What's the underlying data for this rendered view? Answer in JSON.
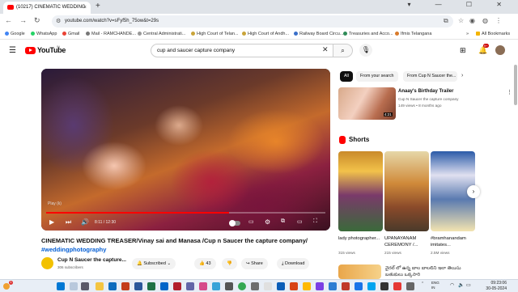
{
  "browser": {
    "tab_title": "(10217) CINEMATIC WEDDING",
    "tab_close": "×",
    "new_tab": "+",
    "window_controls": "▾ — ☐ ✕",
    "url": "youtube.com/watch?v=sFyf5h_75ow&t=29s",
    "bookmarks": [
      "Google",
      "WhatsApp",
      "Gmail",
      "Mail - RAMCHANDE...",
      "Central Administrati...",
      "High Court of Telan...",
      "High Court of Andh...",
      "Railway Board Circu...",
      "Treasuries and Acco...",
      "Ifmis Telangana"
    ],
    "all_bookmarks": "All Bookmarks"
  },
  "youtube": {
    "logo_text": "YouTube",
    "region": "IN",
    "search_query": "cup and saucer capture company",
    "notifications": "9+"
  },
  "player": {
    "chapter_label": "Play (k)",
    "time": "8:11 / 12:30",
    "progress": 0.655
  },
  "video": {
    "title": "CINEMATIC WEDDING TREASER/Vinay sai and Manasa /Cup n Saucer the capture company/",
    "hashtag": "#weddingphotography",
    "channel": "Cup N Saucer the capture...",
    "subscribers": "306 subscribers",
    "subscribe_label": "Subscribed",
    "likes": "43",
    "share_label": "Share",
    "download_label": "Download"
  },
  "chips": [
    "All",
    "From your search",
    "From Cup N Saucer the..."
  ],
  "recommended": {
    "title": "Anaay's Birthday Trailer",
    "channel": "Cup N Saucer the capture company",
    "meta": "149 views • 8 months ago",
    "duration": "4:21"
  },
  "shorts": {
    "label": "Shorts",
    "items": [
      {
        "title": "lady photographer...",
        "views": "315 views"
      },
      {
        "title": "UPANAYANAM CEREMONY /...",
        "views": "215 views"
      },
      {
        "title": "#bramhanandam imitates...",
        "views": "2.5M views"
      }
    ]
  },
  "bottom_rec_title": "వైరల్ లో ఉన్న బాల బాలలిని ఇలా తెలుసు బతుకులు ఒక్కసారి",
  "taskbar": {
    "weather_badge": "1",
    "lang": "ENG",
    "lang_region": "IN",
    "time": "09:23:06",
    "date": "30-05-2024"
  }
}
